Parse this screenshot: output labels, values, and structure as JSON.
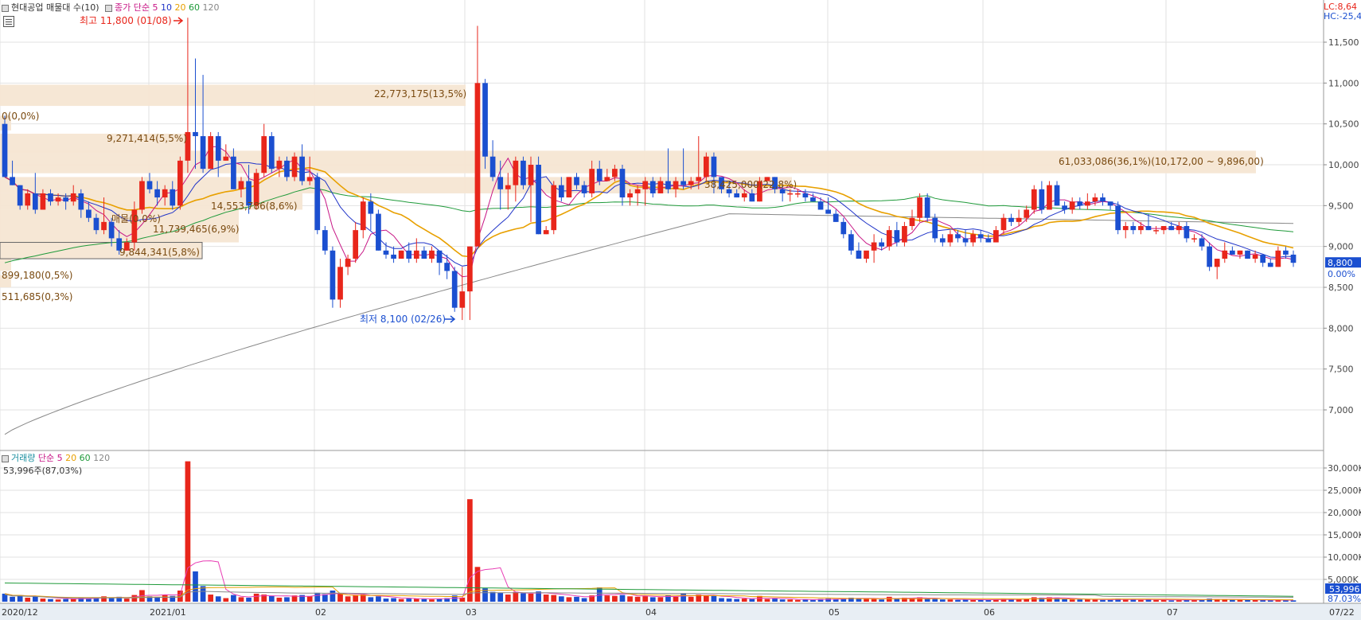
{
  "price_legend": {
    "title": "현대공업 매물대 수(10)",
    "ma_label": "종가 단순",
    "ma": [
      {
        "label": "5",
        "color": "#c71585"
      },
      {
        "label": "10",
        "color": "#2034c8"
      },
      {
        "label": "20",
        "color": "#e8a000"
      },
      {
        "label": "60",
        "color": "#1f9a3a"
      },
      {
        "label": "120",
        "color": "#888888"
      }
    ]
  },
  "volume_legend": {
    "title": "거래량",
    "ma_label": "단순",
    "ma": [
      {
        "label": "5",
        "color": "#c71585"
      },
      {
        "label": "20",
        "color": "#e8a000"
      },
      {
        "label": "60",
        "color": "#1f9a3a"
      },
      {
        "label": "120",
        "color": "#888888"
      }
    ],
    "current": "53,996주(87,03%)"
  },
  "top_right": {
    "lc": "LC:8,64",
    "hc": "HC:-25,4"
  },
  "annotations": {
    "high": "최고 11,800 (01/08)",
    "low": "최저 8,100 (02/26)"
  },
  "price_axis": {
    "ticks": [
      "11,500",
      "11,000",
      "10,500",
      "10,000",
      "9,500",
      "9,000",
      "8,500",
      "8,000",
      "7,500",
      "7,000"
    ],
    "current_badge": "8,800",
    "pct_label": "0.00%"
  },
  "volume_axis": {
    "ticks": [
      "30,000K",
      "25,000K",
      "20,000K",
      "15,000K",
      "10,000K",
      "5,000K"
    ],
    "current_badge": "53,996",
    "pct_label": "87.03%"
  },
  "date_axis": [
    "2020/12",
    "2021/01",
    "02",
    "03",
    "04",
    "05",
    "06",
    "07",
    "07/22"
  ],
  "colors": {
    "up": "#e8261b",
    "down": "#1b4fd0",
    "zone": "#f5e6d3",
    "zone_text": "#7a4a10",
    "grid": "#e2e2e2"
  },
  "chart_data": {
    "type": "candlestick",
    "volume_profile": [
      {
        "price_low": 8500,
        "price_high": 8650,
        "label": "511,685(0,3%)"
      },
      {
        "price_low": 8700,
        "price_high": 8850,
        "label": "899,180(0,5%)"
      },
      {
        "price_low": 8850,
        "price_high": 9050,
        "label": "9,844,341(5,8%)"
      },
      {
        "price_low": 9050,
        "price_high": 9250,
        "label": "11,739,465(6,9%)"
      },
      {
        "price_low": 9250,
        "price_high": 9450,
        "label": "매물(0.0%)"
      },
      {
        "price_low": 9450,
        "price_high": 9650,
        "label": "14,553,786(8,6%)"
      },
      {
        "price_low": 9650,
        "price_high": 9850,
        "label": "38,425,000(22,8%)"
      },
      {
        "price_low": 9896,
        "price_high": 10172,
        "label": "61,033,086(36,1%)(10,172,00 ~ 9,896,00)"
      },
      {
        "price_low": 10150,
        "price_high": 10380,
        "label": "9,271,414(5,5%)"
      },
      {
        "price_low": 10420,
        "price_high": 10600,
        "label": "0(0,0%)"
      },
      {
        "price_low": 10720,
        "price_high": 10980,
        "label": "22,773,175(13,5%)"
      }
    ],
    "candles": [
      [
        10500,
        10600,
        9850,
        9850,
        1800
      ],
      [
        9850,
        10050,
        9750,
        9750,
        1100
      ],
      [
        9750,
        9750,
        9450,
        9500,
        1400
      ],
      [
        9500,
        9700,
        9450,
        9650,
        900
      ],
      [
        9650,
        9900,
        9400,
        9450,
        1300
      ],
      [
        9450,
        9700,
        9450,
        9650,
        700
      ],
      [
        9650,
        9700,
        9500,
        9550,
        600
      ],
      [
        9550,
        9650,
        9500,
        9600,
        500
      ],
      [
        9600,
        9650,
        9450,
        9550,
        600
      ],
      [
        9550,
        9750,
        9500,
        9650,
        700
      ],
      [
        9650,
        9700,
        9350,
        9450,
        900
      ],
      [
        9450,
        9550,
        9300,
        9350,
        700
      ],
      [
        9350,
        9400,
        9150,
        9200,
        900
      ],
      [
        9200,
        9600,
        9150,
        9300,
        1200
      ],
      [
        9300,
        9350,
        9000,
        9100,
        800
      ],
      [
        9100,
        9200,
        8900,
        8950,
        1100
      ],
      [
        8950,
        9100,
        8950,
        9050,
        700
      ],
      [
        9050,
        9550,
        8950,
        9450,
        1500
      ],
      [
        9450,
        9850,
        9400,
        9800,
        2600
      ],
      [
        9800,
        9900,
        9650,
        9700,
        1200
      ],
      [
        9700,
        9800,
        9500,
        9600,
        1100
      ],
      [
        9600,
        9750,
        9500,
        9700,
        1500
      ],
      [
        9700,
        9800,
        9450,
        9500,
        1300
      ],
      [
        9500,
        10100,
        9450,
        10050,
        2500
      ],
      [
        10050,
        11800,
        9900,
        10400,
        31500
      ],
      [
        10400,
        11300,
        9950,
        10350,
        6800
      ],
      [
        10350,
        11100,
        9900,
        9950,
        3500
      ],
      [
        9950,
        10400,
        9950,
        10350,
        1600
      ],
      [
        10350,
        10400,
        9850,
        10050,
        1200
      ],
      [
        10050,
        10250,
        10050,
        10100,
        800
      ],
      [
        10100,
        10200,
        9700,
        9700,
        1500
      ],
      [
        9700,
        9850,
        9600,
        9800,
        1000
      ],
      [
        9800,
        10000,
        9400,
        9500,
        900
      ],
      [
        9500,
        9950,
        9450,
        9900,
        1800
      ],
      [
        9900,
        10500,
        9850,
        10350,
        1600
      ],
      [
        10350,
        10400,
        9900,
        9950,
        1300
      ],
      [
        9950,
        10100,
        9850,
        10050,
        900
      ],
      [
        10050,
        10100,
        9800,
        9850,
        1000
      ],
      [
        9850,
        10150,
        9800,
        10100,
        1400
      ],
      [
        10100,
        10250,
        9750,
        9800,
        1500
      ],
      [
        9800,
        10100,
        9750,
        9850,
        1200
      ],
      [
        9850,
        9900,
        9150,
        9200,
        2000
      ],
      [
        9200,
        9250,
        8900,
        8950,
        1700
      ],
      [
        8950,
        9000,
        8250,
        8350,
        2500
      ],
      [
        8350,
        8850,
        8250,
        8750,
        1800
      ],
      [
        8750,
        8900,
        8650,
        8850,
        1200
      ],
      [
        8850,
        9300,
        8800,
        9200,
        1500
      ],
      [
        9200,
        9600,
        9100,
        9550,
        1600
      ],
      [
        9550,
        9650,
        9200,
        9400,
        1000
      ],
      [
        9400,
        9450,
        8950,
        8950,
        1200
      ],
      [
        8950,
        9050,
        8850,
        8900,
        700
      ],
      [
        8900,
        9000,
        8800,
        8850,
        800
      ],
      [
        8850,
        8950,
        8850,
        8950,
        600
      ],
      [
        8950,
        9050,
        8800,
        8850,
        700
      ],
      [
        8850,
        9100,
        8800,
        8950,
        700
      ],
      [
        8950,
        9000,
        8850,
        8850,
        600
      ],
      [
        8850,
        9000,
        8800,
        8950,
        500
      ],
      [
        8950,
        8950,
        8650,
        8800,
        700
      ],
      [
        8800,
        8900,
        8600,
        8700,
        800
      ],
      [
        8700,
        8750,
        8200,
        8250,
        1400
      ],
      [
        8250,
        8750,
        8100,
        8450,
        900
      ],
      [
        8450,
        9000,
        8100,
        9000,
        23000
      ],
      [
        9000,
        11700,
        9000,
        11000,
        7800
      ],
      [
        11000,
        11050,
        9950,
        10100,
        3000
      ],
      [
        10100,
        10300,
        9800,
        9850,
        2200
      ],
      [
        9850,
        10050,
        9450,
        9700,
        2000
      ],
      [
        9700,
        9900,
        9450,
        9750,
        1600
      ],
      [
        9750,
        10100,
        9550,
        10050,
        2200
      ],
      [
        10050,
        10100,
        9700,
        9750,
        1900
      ],
      [
        9750,
        10100,
        9300,
        10000,
        1800
      ],
      [
        10000,
        10100,
        9150,
        9150,
        2300
      ],
      [
        9150,
        9250,
        9150,
        9200,
        1600
      ],
      [
        9200,
        9800,
        9150,
        9750,
        1500
      ],
      [
        9750,
        9850,
        9550,
        9600,
        1200
      ],
      [
        9600,
        9850,
        9600,
        9850,
        1000
      ],
      [
        9850,
        9900,
        9700,
        9750,
        1100
      ],
      [
        9750,
        9800,
        9600,
        9650,
        800
      ],
      [
        9650,
        10050,
        9600,
        9950,
        1400
      ],
      [
        9950,
        10050,
        9750,
        9800,
        3200
      ],
      [
        9800,
        9950,
        9800,
        9850,
        1400
      ],
      [
        9850,
        10000,
        9800,
        9950,
        1300
      ],
      [
        9950,
        10000,
        9500,
        9600,
        1500
      ],
      [
        9600,
        9700,
        9500,
        9650,
        1200
      ],
      [
        9650,
        9750,
        9500,
        9700,
        1100
      ],
      [
        9700,
        9850,
        9500,
        9800,
        1300
      ],
      [
        9800,
        9850,
        9600,
        9650,
        1000
      ],
      [
        9650,
        9850,
        9650,
        9800,
        1000
      ],
      [
        9800,
        10200,
        9650,
        9700,
        1400
      ],
      [
        9700,
        9850,
        9600,
        9800,
        1100
      ],
      [
        9800,
        10200,
        9700,
        9750,
        1900
      ],
      [
        9750,
        9850,
        9700,
        9800,
        1100
      ],
      [
        9800,
        10350,
        9700,
        9850,
        1600
      ],
      [
        9850,
        10150,
        9800,
        10100,
        1400
      ],
      [
        10100,
        10150,
        9650,
        9850,
        1300
      ],
      [
        9850,
        9800,
        9650,
        9700,
        800
      ],
      [
        9700,
        9800,
        9600,
        9650,
        700
      ],
      [
        9650,
        9700,
        9600,
        9600,
        600
      ],
      [
        9600,
        9700,
        9550,
        9650,
        700
      ],
      [
        9650,
        9700,
        9550,
        9550,
        600
      ],
      [
        9550,
        9850,
        9550,
        9800,
        1300
      ],
      [
        9800,
        9850,
        9800,
        9850,
        600
      ],
      [
        9850,
        9850,
        9650,
        9700,
        700
      ],
      [
        9700,
        9750,
        9550,
        9650,
        500
      ],
      [
        9650,
        9700,
        9550,
        9650,
        500
      ],
      [
        9650,
        9700,
        9600,
        9650,
        400
      ],
      [
        9650,
        9700,
        9550,
        9600,
        500
      ],
      [
        9600,
        9650,
        9550,
        9550,
        400
      ],
      [
        9550,
        9600,
        9450,
        9450,
        600
      ],
      [
        9450,
        9600,
        9400,
        9400,
        700
      ],
      [
        9400,
        9450,
        9300,
        9300,
        600
      ],
      [
        9300,
        9350,
        9100,
        9150,
        800
      ],
      [
        9150,
        9200,
        8900,
        8950,
        900
      ],
      [
        8950,
        9050,
        8850,
        8850,
        800
      ],
      [
        8850,
        8850,
        8800,
        8950,
        700
      ],
      [
        8950,
        9150,
        8800,
        9050,
        600
      ],
      [
        9050,
        9100,
        8950,
        9000,
        500
      ],
      [
        9000,
        9250,
        8950,
        9200,
        1100
      ],
      [
        9200,
        9300,
        9000,
        9050,
        700
      ],
      [
        9050,
        9300,
        9000,
        9250,
        900
      ],
      [
        9250,
        9450,
        9200,
        9350,
        800
      ],
      [
        9350,
        9650,
        9300,
        9600,
        1000
      ],
      [
        9600,
        9650,
        9300,
        9350,
        700
      ],
      [
        9350,
        9400,
        9050,
        9100,
        600
      ],
      [
        9100,
        9150,
        9000,
        9050,
        500
      ],
      [
        9050,
        9200,
        9000,
        9150,
        500
      ],
      [
        9150,
        9200,
        9050,
        9100,
        400
      ],
      [
        9100,
        9200,
        9000,
        9050,
        500
      ],
      [
        9050,
        9200,
        9000,
        9150,
        400
      ],
      [
        9150,
        9200,
        9050,
        9100,
        400
      ],
      [
        9100,
        9150,
        9050,
        9050,
        400
      ],
      [
        9050,
        9250,
        9050,
        9200,
        500
      ],
      [
        9200,
        9400,
        9150,
        9350,
        700
      ],
      [
        9350,
        9400,
        9250,
        9300,
        500
      ],
      [
        9300,
        9450,
        9250,
        9350,
        600
      ],
      [
        9350,
        9500,
        9300,
        9450,
        700
      ],
      [
        9450,
        9750,
        9400,
        9700,
        1000
      ],
      [
        9700,
        9800,
        9400,
        9450,
        900
      ],
      [
        9450,
        9800,
        9450,
        9750,
        1000
      ],
      [
        9750,
        9800,
        9500,
        9500,
        800
      ],
      [
        9500,
        9550,
        9400,
        9450,
        600
      ],
      [
        9450,
        9600,
        9400,
        9550,
        500
      ],
      [
        9550,
        9600,
        9450,
        9500,
        500
      ],
      [
        9500,
        9650,
        9450,
        9550,
        500
      ],
      [
        9550,
        9650,
        9500,
        9600,
        500
      ],
      [
        9600,
        9650,
        9500,
        9550,
        400
      ],
      [
        9550,
        9550,
        9450,
        9500,
        400
      ],
      [
        9500,
        9550,
        9150,
        9200,
        700
      ],
      [
        9200,
        9300,
        9100,
        9250,
        500
      ],
      [
        9250,
        9300,
        9150,
        9200,
        500
      ],
      [
        9200,
        9300,
        9150,
        9250,
        400
      ],
      [
        9250,
        9400,
        9200,
        9200,
        500
      ],
      [
        9200,
        9250,
        9150,
        9200,
        400
      ],
      [
        9200,
        9250,
        9150,
        9250,
        400
      ],
      [
        9250,
        9300,
        9200,
        9200,
        300
      ],
      [
        9200,
        9300,
        9150,
        9250,
        400
      ],
      [
        9250,
        9300,
        9050,
        9100,
        500
      ],
      [
        9100,
        9150,
        9050,
        9100,
        400
      ],
      [
        9100,
        9150,
        8950,
        9000,
        500
      ],
      [
        9000,
        9050,
        8700,
        8750,
        700
      ],
      [
        8750,
        8850,
        8600,
        8850,
        600
      ],
      [
        8850,
        9050,
        8800,
        8950,
        500
      ],
      [
        8950,
        9000,
        8900,
        8900,
        400
      ],
      [
        8900,
        8950,
        8850,
        8950,
        400
      ],
      [
        8950,
        8950,
        8850,
        8850,
        400
      ],
      [
        8850,
        8950,
        8800,
        8900,
        400
      ],
      [
        8900,
        8900,
        8750,
        8800,
        400
      ],
      [
        8800,
        8850,
        8750,
        8750,
        300
      ],
      [
        8750,
        9000,
        8750,
        8950,
        400
      ],
      [
        8950,
        9000,
        8850,
        8900,
        300
      ],
      [
        8900,
        8950,
        8750,
        8800,
        300
      ]
    ],
    "ylim": [
      6600,
      11950
    ],
    "vol_ylim": [
      0,
      33000
    ]
  }
}
